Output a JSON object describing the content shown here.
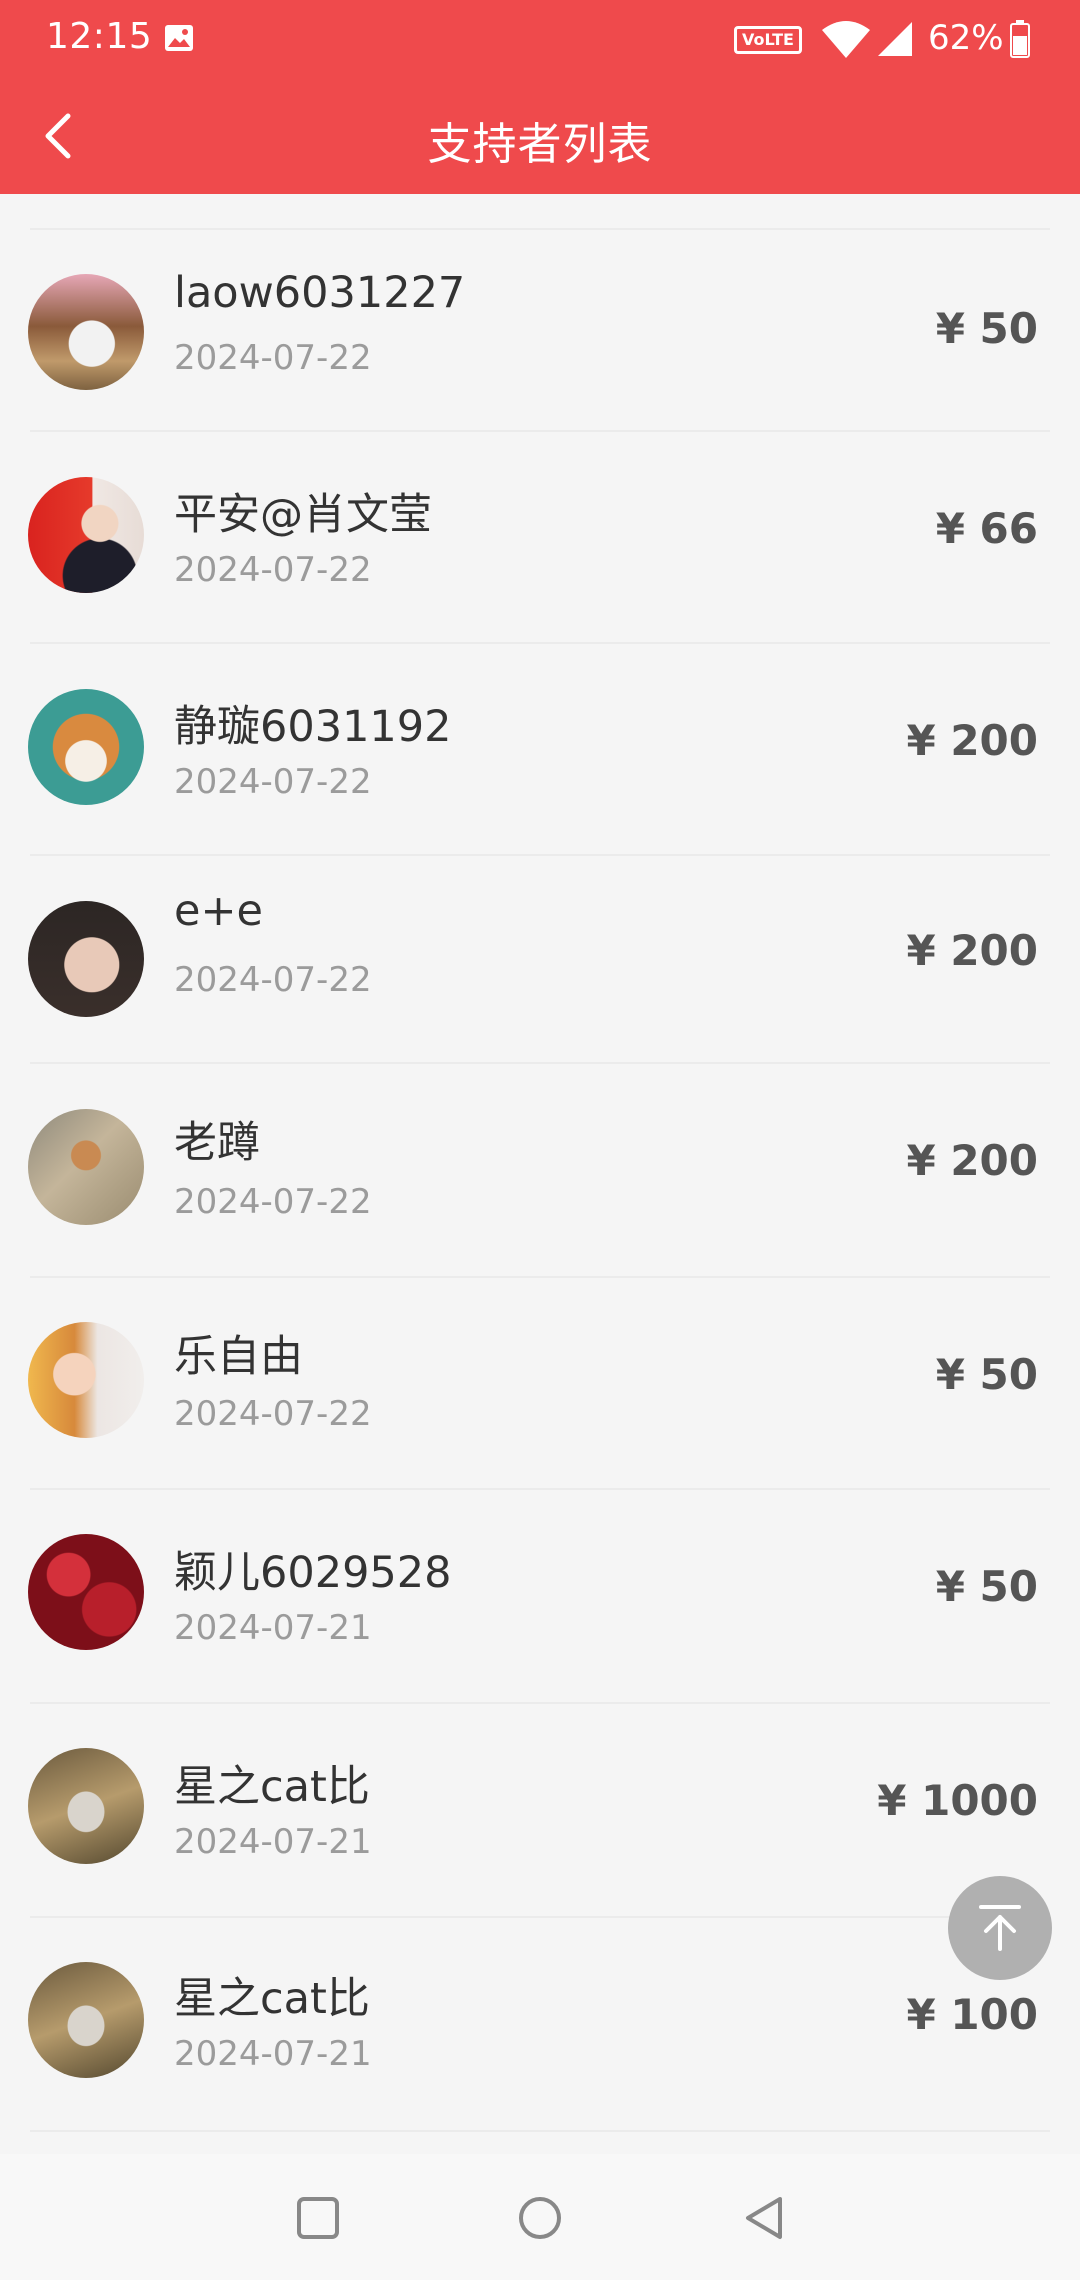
{
  "status_bar": {
    "time": "12:15",
    "volte": "VoLTE",
    "battery": "62%"
  },
  "header": {
    "title": "支持者列表"
  },
  "supporters": [
    {
      "name": "laow6031227",
      "date": "2024-07-22",
      "amount": "¥ 50",
      "avatar": "cat-avatar"
    },
    {
      "name": "平安@肖文莹",
      "date": "2024-07-22",
      "amount": "¥ 66",
      "avatar": "flag-portrait-avatar"
    },
    {
      "name": "静璇6031192",
      "date": "2024-07-22",
      "amount": "¥ 200",
      "avatar": "shiba-avatar"
    },
    {
      "name": "e+e",
      "date": "2024-07-22",
      "amount": "¥ 200",
      "avatar": "woman-portrait-avatar"
    },
    {
      "name": "老蹲",
      "date": "2024-07-22",
      "amount": "¥ 200",
      "avatar": "kitten-avatar"
    },
    {
      "name": "乐自由",
      "date": "2024-07-22",
      "amount": "¥ 50",
      "avatar": "illustrated-girl-avatar"
    },
    {
      "name": "颖儿6029528",
      "date": "2024-07-21",
      "amount": "¥ 50",
      "avatar": "rose-avatar"
    },
    {
      "name": "星之cat比",
      "date": "2024-07-21",
      "amount": "¥ 1000",
      "avatar": "tabby-cat-avatar"
    },
    {
      "name": "星之cat比",
      "date": "2024-07-21",
      "amount": "¥ 100",
      "avatar": "tabby-cat-avatar"
    }
  ],
  "colors": {
    "accent": "#ef4a4c",
    "background": "#f5f5f5"
  }
}
